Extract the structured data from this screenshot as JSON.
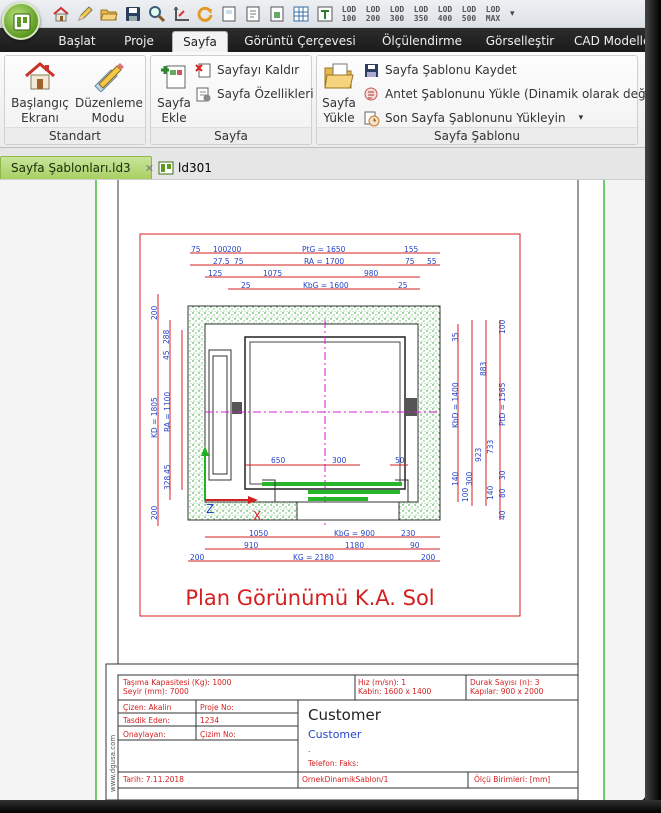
{
  "qat": {
    "lod_buttons": [
      {
        "top": "LOD",
        "bottom": "100"
      },
      {
        "top": "LOD",
        "bottom": "200"
      },
      {
        "top": "LOD",
        "bottom": "300"
      },
      {
        "top": "LOD",
        "bottom": "350"
      },
      {
        "top": "LOD",
        "bottom": "400"
      },
      {
        "top": "LOD",
        "bottom": "500"
      },
      {
        "top": "LOD",
        "bottom": "MAX"
      }
    ],
    "icons": [
      "home-icon",
      "pencil-icon",
      "open-folder-icon",
      "save-icon",
      "search-icon",
      "coordinate-icon",
      "refresh-icon",
      "page-icon",
      "edit-page-icon",
      "insert-icon",
      "columns-icon",
      "text-icon"
    ]
  },
  "menu_tabs": [
    "Başlat",
    "Proje",
    "Sayfa",
    "Görüntü Çerçevesi",
    "Ölçülendirme",
    "Görselleştir",
    "CAD Modelleme"
  ],
  "active_tab": "Sayfa",
  "ribbon": {
    "standart": {
      "label": "Standart",
      "home": {
        "line1": "Başlangıç",
        "line2": "Ekranı"
      },
      "edit": {
        "line1": "Düzenleme",
        "line2": "Modu"
      }
    },
    "sayfa": {
      "label": "Sayfa",
      "add": {
        "line1": "Sayfa",
        "line2": "Ekle"
      },
      "remove": "Sayfayı Kaldır",
      "props": "Sayfa Özellikleri"
    },
    "sablon": {
      "label": "Sayfa Şablonu",
      "load": {
        "line1": "Sayfa",
        "line2": "Yükle"
      },
      "save": "Sayfa Şablonu Kaydet",
      "title_block": "Antet Şablonunu Yükle (Dinamik olarak değil)",
      "last": "Son Sayfa Şablonunu Yükleyin"
    }
  },
  "doc_tabs": [
    {
      "label": "Sayfa Şablonları.ld3",
      "active": true
    },
    {
      "label": "ld301",
      "active": false
    }
  ],
  "drawing": {
    "title": "Plan Görünümü K.A. Sol",
    "dims_top": {
      "d75": "75",
      "d100": "100",
      "d200": "200",
      "ptg": "PtG = 1650",
      "d155": "155",
      "d275": "27.5",
      "d75b": "75",
      "ra": "RA = 1700",
      "d75c": "75",
      "d55": "55",
      "d125": "125",
      "d1075": "1075",
      "d980": "980",
      "d25a": "25",
      "kbg": "KbG = 1600",
      "d25b": "25"
    },
    "dims_left": {
      "d200a": "200",
      "d45": "45",
      "d288": "288",
      "kd": "KD = 1805",
      "ra": "RA = 1100",
      "d328": "328",
      "d45b": "45",
      "d200b": "200"
    },
    "dims_right": {
      "d35": "35",
      "d100": "100",
      "kbd": "KbD = 1400",
      "d883": "883",
      "pd": "PtD = 1565",
      "d923": "923",
      "d733": "733",
      "d140": "140",
      "d100b": "100",
      "d300": "300",
      "d140b": "140",
      "d80": "80",
      "d30": "30",
      "d40": "40"
    },
    "dims_inner": {
      "d650": "650",
      "d300": "300",
      "d50": "50"
    },
    "dims_bottom": {
      "d1050": "1050",
      "kbg": "KbG = 900",
      "d230": "230",
      "d910": "910",
      "d1180": "1180",
      "d90": "90",
      "d200a": "200",
      "kg": "KG = 2180",
      "d200b": "200"
    },
    "axis": {
      "z": "Z",
      "x": "X"
    }
  },
  "title_block": {
    "capacity": "Taşıma Kapasitesi (Kg): 1000",
    "stroke": "Seyir (mm): 7000",
    "speed": "Hız (m/sn): 1",
    "cabin": "Kabin: 1600 x 1400",
    "stops": "Durak Sayısı (n): 3",
    "doors": "Kapılar: 900 x 2000",
    "drawn_by": "Çizen: Akalin",
    "approved": "Tasdik Eden:",
    "confirmed": "Onaylayan:",
    "project_no_label": "Proje No:",
    "project_no": "1234",
    "drawing_no": "Çizim  No:",
    "customer_title": "Customer",
    "customer_sub": "Customer",
    "dot": ".",
    "phone": "Telefon:  Faks:",
    "date": "Tarih: 7.11.2018",
    "template": "OrnekDinamikSablon/1",
    "units": "Ölçü Birimleri: [mm]",
    "website": "www.dgusa.com"
  }
}
